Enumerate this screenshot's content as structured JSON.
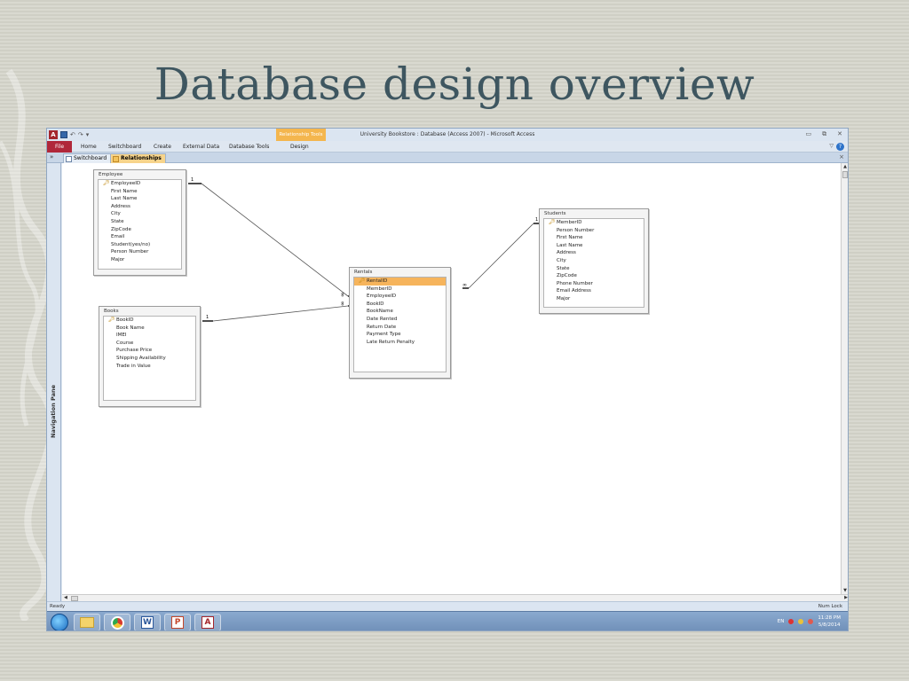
{
  "slide": {
    "title": "Database design overview"
  },
  "app": {
    "window_title": "University Bookstore : Database (Access 2007)  -  Microsoft Access",
    "contextual_tab_title": "Relationship Tools",
    "ribbon_tabs": [
      "File",
      "Home",
      "Switchboard",
      "Create",
      "External Data",
      "Database Tools",
      "Design"
    ],
    "document_tabs": [
      "Switchboard",
      "Relationships"
    ],
    "nav_pane_label": "Navigation Pane",
    "status_left": "Ready",
    "status_right": "Num Lock",
    "colors": {
      "file_tab": "#b0273a",
      "context_tab": "#f4b64e",
      "selected_field": "#f6b45c",
      "canvas": "#ffffff"
    }
  },
  "tables": {
    "employee": {
      "name": "Employee",
      "fields": [
        "EmployeeID",
        "First Name",
        "Last Name",
        "Address",
        "City",
        "State",
        "ZipCode",
        "Email",
        "Student(yes/no)",
        "Person Number",
        "Major"
      ]
    },
    "books": {
      "name": "Books",
      "fields": [
        "BookID",
        "Book Name",
        "IMEI",
        "Course",
        "Purchase Price",
        "Shipping Availability",
        "Trade in Value"
      ]
    },
    "rentals": {
      "name": "Rentals",
      "fields": [
        "RentalID",
        "MemberID",
        "EmployeeID",
        "BookID",
        "BookName",
        "Date Rented",
        "Return Date",
        "Payment Type",
        "Late Return Penalty"
      ]
    },
    "students": {
      "name": "Students",
      "fields": [
        "MemberID",
        "Person Number",
        "First Name",
        "Last Name",
        "Address",
        "City",
        "State",
        "ZipCode",
        "Phone Number",
        "Email Address",
        "Major"
      ]
    }
  },
  "relationships": [
    {
      "from": "Employee.EmployeeID",
      "to": "Rentals.EmployeeID",
      "one_label": "1",
      "many_label": "∞"
    },
    {
      "from": "Books.BookID",
      "to": "Rentals.BookID",
      "one_label": "1",
      "many_label": "∞"
    },
    {
      "from": "Students.MemberID",
      "to": "Rentals.MemberID",
      "one_label": "1",
      "many_label": "∞"
    }
  ],
  "taskbar": {
    "apps": [
      "start-orb",
      "folder-icon",
      "chrome-icon",
      "word-icon",
      "powerpoint-icon",
      "access-icon"
    ],
    "tray_lang": "EN",
    "clock_time": "11:28 PM",
    "clock_date": "5/8/2014"
  }
}
